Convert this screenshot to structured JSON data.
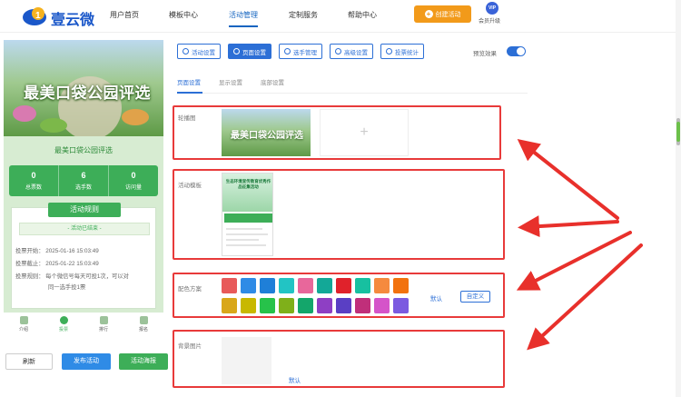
{
  "brand": {
    "name": "壹云微"
  },
  "nav": [
    "用户首页",
    "模板中心",
    "活动管理",
    "定制服务",
    "帮助中心"
  ],
  "nav_active": 2,
  "create_button": "创建活动",
  "vip": {
    "badge": "VIP",
    "label": "会员升级"
  },
  "preview": {
    "hero_title": "最美口袋公园评选",
    "event_title": "最美口袋公园评选",
    "stats": [
      {
        "value": "0",
        "label": "总票数"
      },
      {
        "value": "6",
        "label": "选手数"
      },
      {
        "value": "0",
        "label": "访问量"
      }
    ],
    "rules_heading": "活动规则",
    "ended": "- 活动已结束 -",
    "rules": [
      "投票开始：  2025-01-16 15:03:49",
      "投票截止：  2025-01-22 15:03:49",
      "投票规则：  每个微信号每天可投1次，可以对",
      "同一选手投1票"
    ],
    "tabs": [
      "介绍",
      "投票",
      "排行",
      "报名"
    ],
    "tab_active": 1
  },
  "bottom_buttons": [
    "刷新",
    "发布活动",
    "活动海报"
  ],
  "settings_tabs": [
    "活动设置",
    "页面设置",
    "选手管理",
    "高级设置",
    "投票统计"
  ],
  "settings_tab_active": 1,
  "preview_toggle_label": "预览效果",
  "subtabs": [
    "页面设置",
    "显示设置",
    "底部设置"
  ],
  "subtab_active": 0,
  "sections": {
    "carousel": {
      "label": "轮播图",
      "image_text": "最美口袋公园评选",
      "add": "+"
    },
    "template": {
      "label": "活动模板",
      "thumb_title": "生态环境宣传教育优秀作品征集活动"
    },
    "colors": {
      "label": "配色方案",
      "row1": [
        "#e85a5a",
        "#2f8be6",
        "#1f7fd8",
        "#22c4c4",
        "#e8679b",
        "#13a897",
        "#e0222b",
        "#17c0a0",
        "#f58a3e",
        "#f2720e"
      ],
      "row2": [
        "#d9a71a",
        "#c8b800",
        "#27c24a",
        "#7fb01a",
        "#14a66b",
        "#8e3fc4",
        "#5a3fc4",
        "#c02f7a",
        "#d554c9",
        "#7b5ae0"
      ],
      "default": "默认",
      "custom": "自定义"
    },
    "background": {
      "label": "背景图片",
      "default": "默认"
    }
  }
}
